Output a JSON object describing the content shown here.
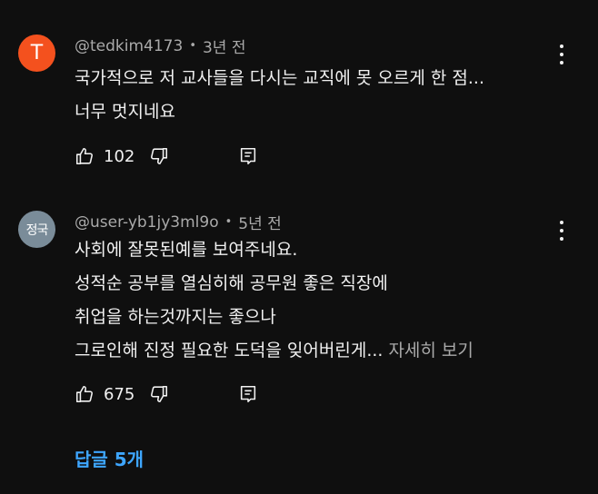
{
  "comments": [
    {
      "avatar_letter": "T",
      "avatar_color": "#f4511e",
      "author": "@tedkim4173",
      "time": "3년 전",
      "lines": [
        "국가적으로 저 교사들을 다시는 교직에 못 오르게 한 점...",
        "너무 멋지네요"
      ],
      "likes": "102"
    },
    {
      "avatar_letter": "정국",
      "avatar_color": "#7a8c99",
      "author": "@user-yb1jy3ml9o",
      "time": "5년 전",
      "lines": [
        "사회에 잘못된예를 보여주네요.",
        "성적순 공부를 열심히해 공무원 좋은 직장에",
        "취업을 하는것까지는 좋으나",
        "그로인해 진정 필요한 도덕을 잊어버린게..."
      ],
      "read_more": "자세히 보기",
      "likes": "675"
    }
  ],
  "replies_label": "답글 5개",
  "icons": {
    "like": "thumbs-up-icon",
    "dislike": "thumbs-down-icon",
    "reply": "comment-reply-icon",
    "more": "more-vertical-icon"
  }
}
